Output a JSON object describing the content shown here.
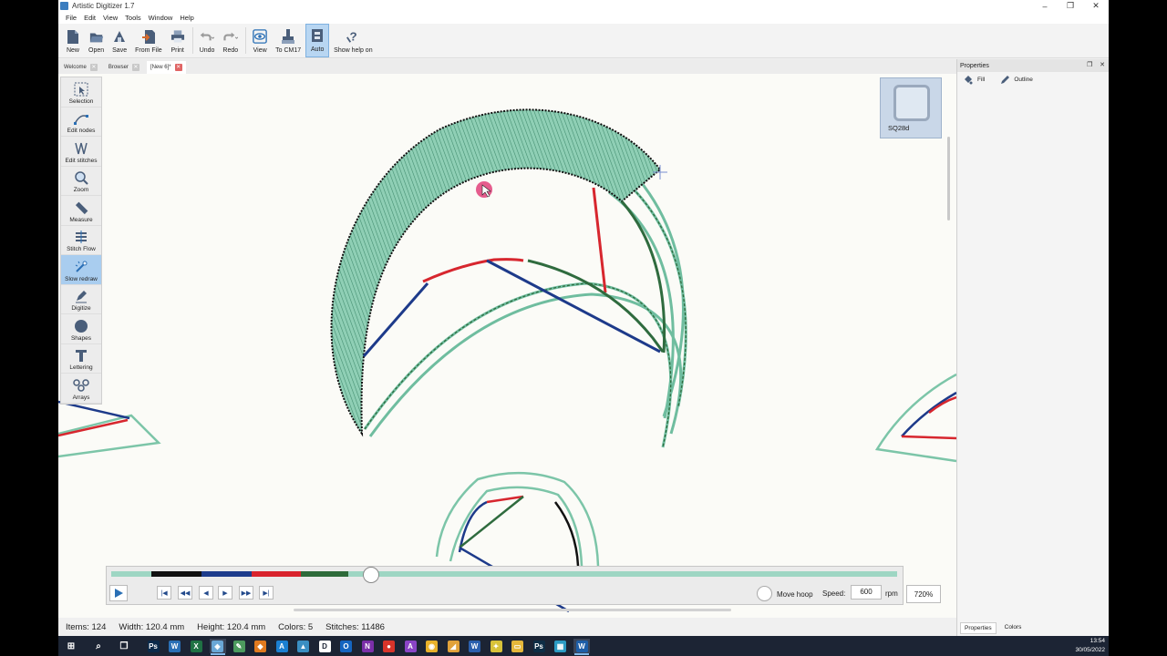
{
  "window": {
    "title": "Artistic Digitizer 1.7"
  },
  "menu": [
    "File",
    "Edit",
    "View",
    "Tools",
    "Window",
    "Help"
  ],
  "toolbar": {
    "new": "New",
    "open": "Open",
    "save": "Save",
    "from_file": "From File",
    "print": "Print",
    "undo": "Undo",
    "redo": "Redo",
    "view": "View",
    "to_cm17": "To CM17",
    "auto": "Auto",
    "show_help": "Show help on"
  },
  "tabs": [
    {
      "label": "Welcome",
      "active": false
    },
    {
      "label": "Browser",
      "active": false
    },
    {
      "label": "[New 6]*",
      "active": true
    }
  ],
  "palette": [
    {
      "label": "Selection",
      "icon": "selection-arrow-icon",
      "active": false
    },
    {
      "label": "Edit nodes",
      "icon": "edit-nodes-icon",
      "active": false
    },
    {
      "label": "Edit stitches",
      "icon": "edit-stitches-icon",
      "active": false
    },
    {
      "label": "Zoom",
      "icon": "magnifier-icon",
      "active": false
    },
    {
      "label": "Measure",
      "icon": "ruler-icon",
      "active": false
    },
    {
      "label": "Stitch Flow",
      "icon": "stitch-flow-icon",
      "active": false
    },
    {
      "label": "Slow redraw",
      "icon": "slow-redraw-icon",
      "active": true
    },
    {
      "label": "Digitize",
      "icon": "pen-icon",
      "active": false
    },
    {
      "label": "Shapes",
      "icon": "circle-shape-icon",
      "active": false
    },
    {
      "label": "Lettering",
      "icon": "letter-t-icon",
      "active": false
    },
    {
      "label": "Arrays",
      "icon": "arrays-icon",
      "active": false
    }
  ],
  "hoop": {
    "label": "SQ28d"
  },
  "playback": {
    "progress": 0.33,
    "move_hoop": "Move hoop",
    "speed_label": "Speed:",
    "speed_value": "600",
    "rpm": "rpm",
    "zoom": "720%",
    "colors": [
      "#111111",
      "#1d3c8c",
      "#d9232d",
      "#2e6b3a"
    ]
  },
  "status": {
    "items": "Items: 124",
    "width": "Width: 120.4 mm",
    "height": "Height: 120.4 mm",
    "colors": "Colors: 5",
    "stitches": "Stitches: 11486"
  },
  "properties": {
    "title": "Properties",
    "tabs": [
      "Fill",
      "Outline"
    ],
    "bottom_tabs": [
      "Properties",
      "Colors"
    ]
  },
  "thread_colors": {
    "fill": "#7cc5a8",
    "dark": "#2f6b3e",
    "red": "#d7262e",
    "blue": "#1d3a8a",
    "black": "#111111"
  },
  "taskbar": {
    "time": "13:54",
    "date": "30/05/2022",
    "apps": [
      {
        "name": "windows-start-icon",
        "color": "#ffffff",
        "glyph": "⊞"
      },
      {
        "name": "search-icon",
        "color": "#ffffff",
        "glyph": "⌕"
      },
      {
        "name": "task-view-icon",
        "color": "#ffffff",
        "glyph": "❐"
      },
      {
        "name": "photoshop-icon",
        "color": "#0b2a4a",
        "glyph": "Ps"
      },
      {
        "name": "app-w-icon",
        "color": "#2a6fb5",
        "glyph": "W"
      },
      {
        "name": "excel-icon",
        "color": "#1f7244",
        "glyph": "X"
      },
      {
        "name": "digitizer-icon",
        "color": "#6aa7d6",
        "glyph": "◈"
      },
      {
        "name": "app-green-icon",
        "color": "#4c9a5e",
        "glyph": "✎"
      },
      {
        "name": "app-orange-icon",
        "color": "#e07a1f",
        "glyph": "◆"
      },
      {
        "name": "affinity-icon",
        "color": "#1b7fd1",
        "glyph": "A"
      },
      {
        "name": "app-teal-icon",
        "color": "#3a8ec2",
        "glyph": "▲"
      },
      {
        "name": "dictionary-icon",
        "color": "#ffffff",
        "glyph": "D"
      },
      {
        "name": "outlook-icon",
        "color": "#1565c0",
        "glyph": "O"
      },
      {
        "name": "onenote-icon",
        "color": "#7b2fa8",
        "glyph": "N"
      },
      {
        "name": "app-red-icon",
        "color": "#d8342a",
        "glyph": "●"
      },
      {
        "name": "affinity-publisher-icon",
        "color": "#8a44c6",
        "glyph": "A"
      },
      {
        "name": "chrome-icon",
        "color": "#e8b12a",
        "glyph": "◉"
      },
      {
        "name": "app-gold-icon",
        "color": "#e1a23a",
        "glyph": "◢"
      },
      {
        "name": "word-icon",
        "color": "#2b5fad",
        "glyph": "W"
      },
      {
        "name": "app-yellow-icon",
        "color": "#d8c23a",
        "glyph": "✦"
      },
      {
        "name": "file-explorer-icon",
        "color": "#e5b73b",
        "glyph": "▭"
      },
      {
        "name": "photoshop-alt-icon",
        "color": "#0e2d45",
        "glyph": "Ps"
      },
      {
        "name": "app-aqua-icon",
        "color": "#2b9ac2",
        "glyph": "▦"
      },
      {
        "name": "wilcom-icon",
        "color": "#1e5ea8",
        "glyph": "W"
      }
    ]
  }
}
